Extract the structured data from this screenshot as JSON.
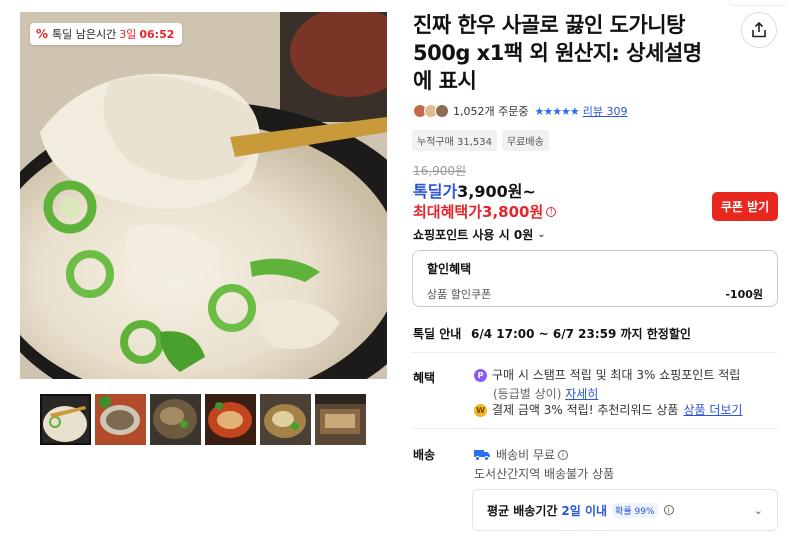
{
  "timer_badge": {
    "percent_icon": "%",
    "label": "톡딜 남은시간",
    "days": "3일",
    "time": "06:52",
    "accent": "#e5262c"
  },
  "product": {
    "title": "진짜 한우 사골로 끓인 도가니탕 500g x1팩 외 원산지: 상세설명에 표시",
    "order_count": "1,052개 주문중",
    "rating_stars": "★★★★★",
    "review_label": "리뷰 309",
    "tags": [
      "누적구매 31,534",
      "무료배송"
    ]
  },
  "price": {
    "original": "16,900원",
    "deal_label": "톡딜가",
    "deal_value": "3,900원~",
    "max_label": "최대혜택가",
    "max_value": "3,800원",
    "coupon_button": "쿠폰 받기",
    "point_usage": "쇼핑포인트 사용 시 0원"
  },
  "discount_box": {
    "heading": "할인혜택",
    "row_label": "상품 할인쿠폰",
    "row_amount": "-100원"
  },
  "notice": {
    "label": "톡딜 안내",
    "value": "6/4 17:00 ~ 6/7 23:59 까지 한정할인"
  },
  "benefit": {
    "label": "혜택",
    "line1": "구매 시 스탬프 적립 및 최대 3% 쇼핑포인트 적립",
    "line1_sub": "(등급별 상이)",
    "line1_link": "자세히",
    "line2": "결제 금액 3% 적립! 추천리워드 상품",
    "line2_link": "상품 더보기"
  },
  "shipping": {
    "label": "배송",
    "fee": "배송비 무료",
    "restriction": "도서산간지역 배송불가 상품",
    "avg_label": "평균 배송기간",
    "avg_value": "2일 이내",
    "probability": "확률 99%"
  },
  "colors": {
    "accent_red": "#e8271f",
    "link_blue": "#2a55d8",
    "star_blue": "#2a6df4"
  },
  "icons": {
    "share": "share-icon",
    "info": "info-icon",
    "truck": "truck-icon",
    "chevron": "chevron-down-icon"
  }
}
